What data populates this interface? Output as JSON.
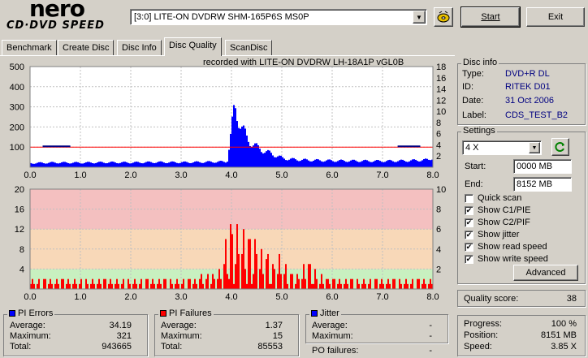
{
  "app": {
    "logo_top": "nero",
    "logo_bottom": "CD·DVD SPEED"
  },
  "toolbar": {
    "drive": "[3:0]  LITE-ON DVDRW SHM-165P6S MS0P",
    "start_label": "Start",
    "exit_label": "Exit"
  },
  "tabs": [
    {
      "label": "Benchmark"
    },
    {
      "label": "Create Disc"
    },
    {
      "label": "Disc Info"
    },
    {
      "label": "Disc Quality"
    },
    {
      "label": "ScanDisc"
    }
  ],
  "chart_caption": "recorded with LITE-ON DVDRW LH-18A1P   vGL0B",
  "chart_data": [
    {
      "type": "area",
      "title": "PI Errors",
      "y_left_ticks": [
        "500",
        "400",
        "300",
        "200",
        "100"
      ],
      "y_right_ticks": [
        "18",
        "16",
        "14",
        "12",
        "10",
        "8",
        "6",
        "4",
        "2"
      ],
      "x_ticks": [
        "0.0",
        "1.0",
        "2.0",
        "3.0",
        "4.0",
        "5.0",
        "6.0",
        "7.0",
        "8.0"
      ],
      "ylim": [
        0,
        500
      ],
      "xlim": [
        0,
        8
      ],
      "x": [
        0.0,
        0.5,
        1.0,
        1.5,
        2.0,
        2.5,
        3.0,
        3.5,
        3.9,
        4.0,
        4.05,
        4.1,
        4.2,
        4.3,
        4.5,
        4.7,
        4.9,
        5.0,
        5.2,
        5.5,
        6.0,
        6.5,
        7.0,
        7.5,
        7.9,
        8.0
      ],
      "values": [
        22,
        25,
        24,
        26,
        25,
        27,
        26,
        28,
        30,
        230,
        320,
        280,
        210,
        150,
        105,
        80,
        60,
        48,
        42,
        38,
        35,
        34,
        33,
        35,
        40,
        55
      ],
      "speed_line_y": 100,
      "series_colors": {
        "bars": "#0000ff",
        "speed": "#ff0000",
        "write_speed": "#000080"
      }
    },
    {
      "type": "bar",
      "title": "PI Failures",
      "y_left_ticks": [
        "20",
        "16",
        "12",
        "8",
        "4"
      ],
      "y_right_ticks": [
        "10",
        "8",
        "6",
        "4",
        "2"
      ],
      "x_ticks": [
        "0.0",
        "1.0",
        "2.0",
        "3.0",
        "4.0",
        "5.0",
        "6.0",
        "7.0",
        "8.0"
      ],
      "ylim": [
        0,
        20
      ],
      "xlim": [
        0,
        8
      ],
      "x": [
        0.0,
        0.5,
        1.0,
        1.5,
        2.0,
        2.5,
        3.0,
        3.5,
        3.8,
        3.9,
        4.0,
        4.1,
        4.2,
        4.3,
        4.4,
        4.5,
        4.6,
        4.7,
        4.8,
        4.9,
        5.0,
        5.1,
        5.2,
        5.3,
        5.4,
        5.5,
        5.6,
        5.7,
        5.8,
        6.0,
        6.5,
        7.0,
        7.5,
        8.0
      ],
      "values": [
        2,
        2,
        2,
        2,
        2,
        2,
        2,
        3,
        4,
        14,
        15,
        13,
        12,
        13,
        11,
        10,
        7,
        8,
        5,
        7,
        6,
        4,
        3,
        3,
        4,
        7,
        5,
        3,
        3,
        2,
        2,
        2,
        2,
        2
      ],
      "bands": [
        {
          "from": 0,
          "to": 4,
          "color": "#c8f0c0"
        },
        {
          "from": 4,
          "to": 12,
          "color": "#f8d8b8"
        },
        {
          "from": 12,
          "to": 20,
          "color": "#f4c0c0"
        }
      ],
      "series_colors": {
        "bars": "#ff0000"
      }
    }
  ],
  "stats": {
    "pi_errors": {
      "title": "PI Errors",
      "average_label": "Average:",
      "average": "34.19",
      "maximum_label": "Maximum:",
      "maximum": "321",
      "total_label": "Total:",
      "total": "943665",
      "color": "#0000ff"
    },
    "pi_failures": {
      "title": "PI Failures",
      "average_label": "Average:",
      "average": "1.37",
      "maximum_label": "Maximum:",
      "maximum": "15",
      "total_label": "Total:",
      "total": "85553",
      "color": "#ff0000"
    },
    "jitter": {
      "title": "Jitter",
      "average_label": "Average:",
      "average": "-",
      "maximum_label": "Maximum:",
      "maximum": "-",
      "po_label": "PO failures:",
      "po": "-",
      "color": "#0000ff"
    }
  },
  "disc_info": {
    "title": "Disc info",
    "type_label": "Type:",
    "type": "DVD+R DL",
    "id_label": "ID:",
    "id": "RITEK D01",
    "date_label": "Date:",
    "date": "31 Oct 2006",
    "label_label": "Label:",
    "label": "CDS_TEST_B2"
  },
  "settings": {
    "title": "Settings",
    "speed": "4 X",
    "start_label": "Start:",
    "start": "0000 MB",
    "end_label": "End:",
    "end": "8152 MB",
    "checks": [
      {
        "label": "Quick scan",
        "checked": false
      },
      {
        "label": "Show C1/PIE",
        "checked": true
      },
      {
        "label": "Show C2/PIF",
        "checked": true
      },
      {
        "label": "Show jitter",
        "checked": true
      },
      {
        "label": "Show read speed",
        "checked": true
      },
      {
        "label": "Show write speed",
        "checked": true
      }
    ],
    "advanced_label": "Advanced"
  },
  "quality": {
    "label": "Quality score:",
    "value": "38"
  },
  "progress": {
    "progress_label": "Progress:",
    "progress": "100 %",
    "position_label": "Position:",
    "position": "8151 MB",
    "speed_label": "Speed:",
    "speed": "3.85 X"
  }
}
